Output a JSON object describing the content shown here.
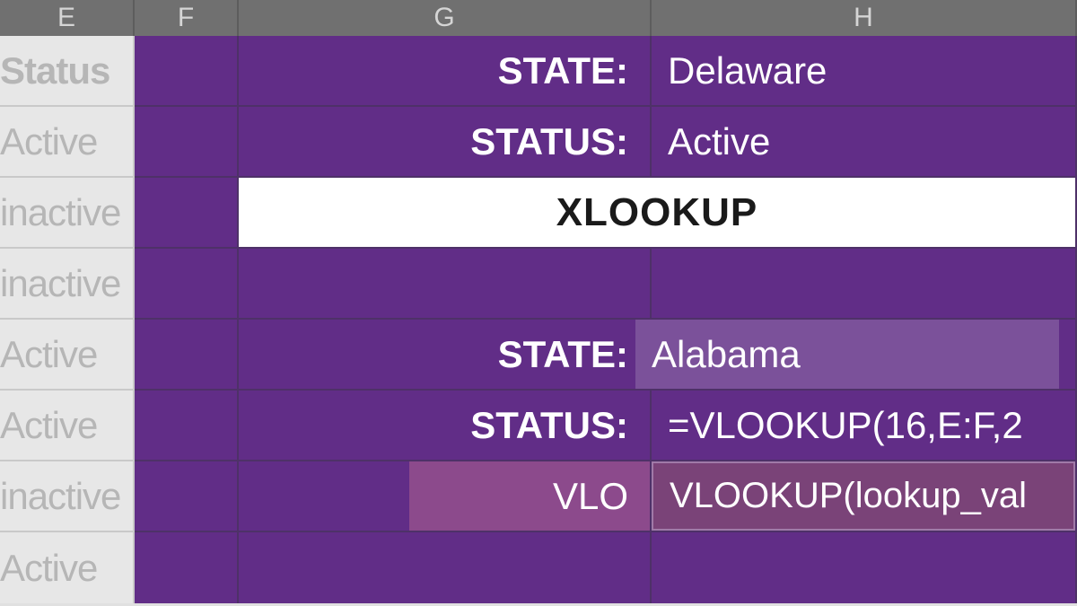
{
  "columns": {
    "e": "E",
    "f": "F",
    "g": "G",
    "h": "H"
  },
  "left_cells": {
    "r1": "Status",
    "r2": "Active",
    "r3": "inactive",
    "r4": "inactive",
    "r5": "Active",
    "r6": "Active",
    "r7": "inactive",
    "r8": "Active"
  },
  "label": {
    "state": "STATE:",
    "status": "STATUS:"
  },
  "val": {
    "state1": "Delaware",
    "status1": "Active",
    "state2": "Alabama",
    "formula": "=VLOOKUP(16,E:F,2"
  },
  "xlookup": "XLOOKUP",
  "vlo_label": "VLO",
  "tooltip": "VLOOKUP(lookup_val",
  "colors": {
    "purple_bg": "#612D87",
    "purple_light": "#7B519A",
    "magenta": "#8C4A8C",
    "tooltip_bg": "#7A4378",
    "header_gray": "#707070",
    "left_gray": "#E7E7E7"
  }
}
